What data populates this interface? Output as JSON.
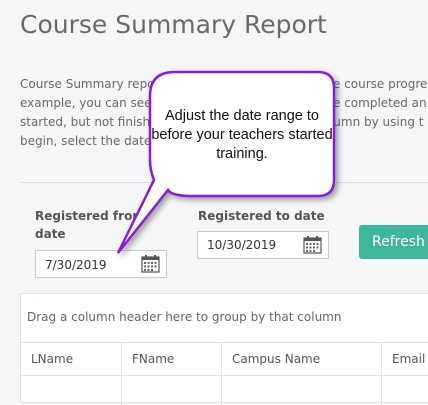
{
  "page": {
    "title": "Course Summary Report",
    "description_lines": [
      "Course Summary repo",
      "example, you can see",
      "started, but not finish",
      "begin, select the date"
    ],
    "description_right_lines": [
      "e course progre",
      "e completed an",
      "column by using t",
      ""
    ]
  },
  "filters": {
    "registered_from_label_line1": "Registered from",
    "registered_from_label_line2": "date",
    "registered_from_value": "7/30/2019",
    "registered_to_label": "Registered to date",
    "registered_to_value": "10/30/2019",
    "refresh_label": "Refresh"
  },
  "grid": {
    "group_hint": "Drag a column header here to group by that column",
    "columns": [
      "LName",
      "FName",
      "Campus Name",
      "Email"
    ]
  },
  "callout": {
    "text": "Adjust the date range to before your teachers started training.",
    "border_color": "#8a1fd6"
  },
  "colors": {
    "accent": "#3fb59a",
    "callout_border": "#8a1fd6"
  }
}
